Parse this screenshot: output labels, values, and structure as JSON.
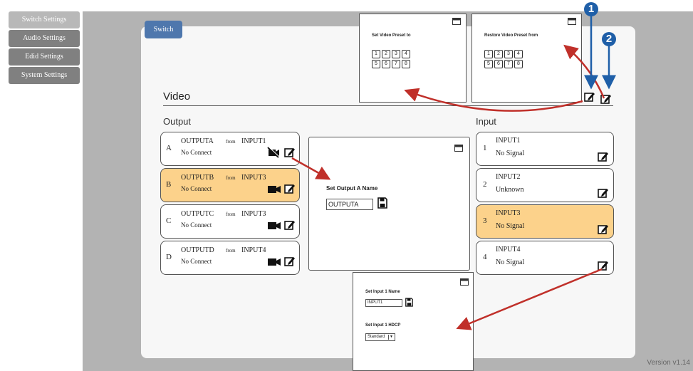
{
  "nav": [
    "Switch Settings",
    "Audio Settings",
    "Edid Settings",
    "System Settings"
  ],
  "tab": "Switch",
  "section_title": "Video",
  "output_title": "Output",
  "input_title": "Input",
  "outputs": [
    {
      "letter": "A",
      "name": "OUTPUTA",
      "from": "from",
      "source": "INPUT1",
      "status": "No Connect"
    },
    {
      "letter": "B",
      "name": "OUTPUTB",
      "from": "from",
      "source": "INPUT3",
      "status": "No Connect"
    },
    {
      "letter": "C",
      "name": "OUTPUTC",
      "from": "from",
      "source": "INPUT3",
      "status": "No Connect"
    },
    {
      "letter": "D",
      "name": "OUTPUTD",
      "from": "from",
      "source": "INPUT4",
      "status": "No Connect"
    }
  ],
  "inputs": [
    {
      "num": "1",
      "name": "INPUT1",
      "status": "No Signal"
    },
    {
      "num": "2",
      "name": "INPUT2",
      "status": "Unknown"
    },
    {
      "num": "3",
      "name": "INPUT3",
      "status": "No Signal"
    },
    {
      "num": "4",
      "name": "INPUT4",
      "status": "No Signal"
    }
  ],
  "popup_set_preset": {
    "label": "Set Video Preset to",
    "nums": [
      "1",
      "2",
      "3",
      "4",
      "5",
      "6",
      "7",
      "8"
    ]
  },
  "popup_restore_preset": {
    "label": "Restore Video Preset from",
    "nums": [
      "1",
      "2",
      "3",
      "4",
      "5",
      "6",
      "7",
      "8"
    ]
  },
  "popup_output_name": {
    "label": "Set Output A Name",
    "value": "OUTPUTA"
  },
  "popup_input": {
    "name_label": "Set Input 1 Name",
    "name_value": "INPUT1",
    "hdcp_label": "Set Input 1 HDCP",
    "hdcp_value": "Standard"
  },
  "callouts": [
    "1",
    "2"
  ],
  "version": "Version v1.14",
  "colors": {
    "selected": "#fcd28b",
    "tab": "#4e77ad",
    "callout": "#1f5fa8",
    "arrow": "#c0302a"
  }
}
